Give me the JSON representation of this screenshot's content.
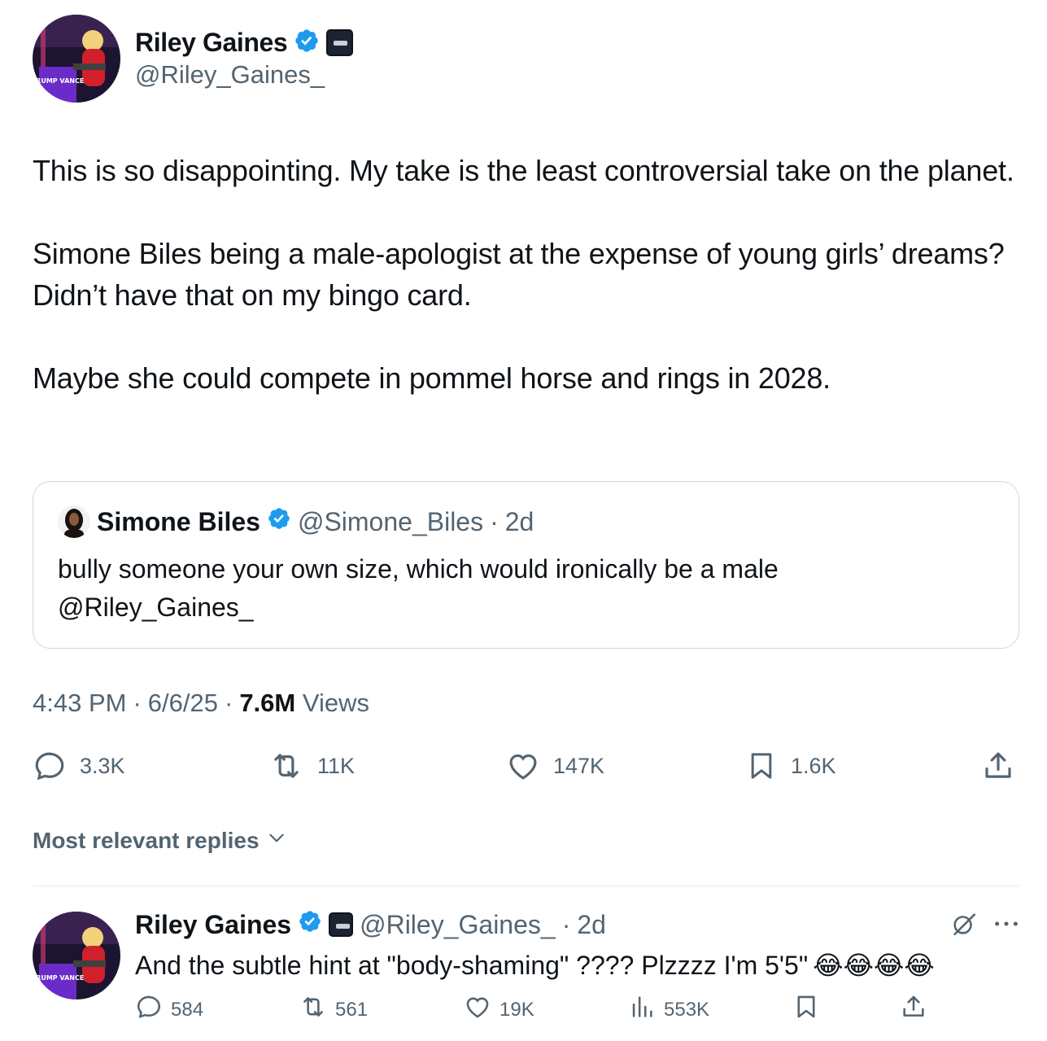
{
  "author": {
    "name": "Riley Gaines",
    "handle": "@Riley_Gaines_",
    "avatar_sign_text": "TRUMP VANCE"
  },
  "tweet": {
    "paragraphs": [
      "This is so disappointing. My take is the least controversial take on the planet.",
      "Simone Biles being a male-apologist at the expense of young girls’ dreams? Didn’t have that on my bingo card.",
      "Maybe she could compete in pommel horse and rings in 2028."
    ],
    "time": "4:43 PM",
    "date": "6/6/25",
    "views_count": "7.6M",
    "views_label": "Views",
    "separator": "·"
  },
  "quote": {
    "name": "Simone Biles",
    "handle": "@Simone_Biles",
    "age": "2d",
    "separator": "·",
    "text_line1": "bully someone your own size, which would ironically be a male",
    "text_line2": "@Riley_Gaines_"
  },
  "actions": {
    "replies": "3.3K",
    "reposts": "11K",
    "likes": "147K",
    "bookmarks": "1.6K"
  },
  "sort": {
    "label": "Most relevant replies"
  },
  "reply": {
    "name": "Riley Gaines",
    "handle": "@Riley_Gaines_",
    "separator": "·",
    "age": "2d",
    "text": "And the subtle hint at \"body-shaming\" ???? Plzzzz I'm 5'5\"",
    "emoji": "😂😂😂😂",
    "replies": "584",
    "reposts": "561",
    "likes": "19K",
    "views": "553K"
  },
  "colors": {
    "verified": "#1d9bf0",
    "secondary_text": "#536471",
    "primary_text": "#0f1419",
    "border": "#cfd9de"
  },
  "icons": [
    "reply-icon",
    "repost-icon",
    "like-icon",
    "bookmark-icon",
    "share-icon",
    "views-icon",
    "verified-icon",
    "grok-icon",
    "more-icon",
    "chevron-down-icon"
  ]
}
